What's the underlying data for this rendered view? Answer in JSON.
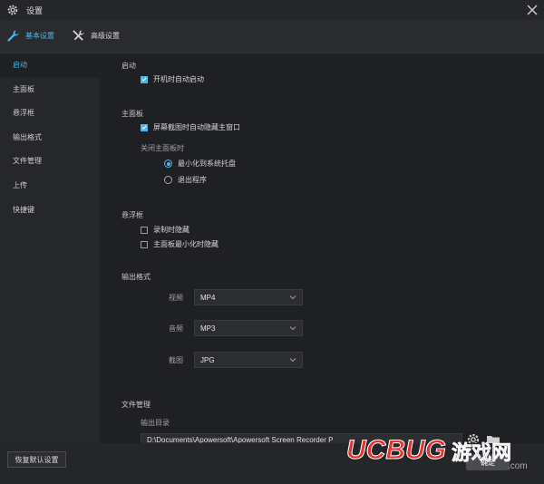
{
  "window": {
    "title": "设置"
  },
  "tabs": [
    {
      "label": "基本设置"
    },
    {
      "label": "高级设置"
    }
  ],
  "sidebar": {
    "items": [
      {
        "label": "启动"
      },
      {
        "label": "主面板"
      },
      {
        "label": "悬浮框"
      },
      {
        "label": "输出格式"
      },
      {
        "label": "文件管理"
      },
      {
        "label": "上传"
      },
      {
        "label": "快捷键"
      }
    ]
  },
  "startup": {
    "title": "启动",
    "auto_start": "开机时自动启动"
  },
  "main_panel": {
    "title": "主面板",
    "hide_on_capture": "屏幕截图时自动隐藏主窗口",
    "close_label": "关闭主面板时",
    "minimize_to_tray": "最小化到系统托盘",
    "exit_program": "退出程序"
  },
  "float_box": {
    "title": "悬浮框",
    "hide_on_record": "录制时隐藏",
    "hide_on_minimize": "主面板最小化时隐藏"
  },
  "output_format": {
    "title": "输出格式",
    "video_label": "视频",
    "video_value": "MP4",
    "audio_label": "音频",
    "audio_value": "MP3",
    "screenshot_label": "截图",
    "screenshot_value": "JPG"
  },
  "file_management": {
    "title": "文件管理",
    "output_dir_label": "输出目录",
    "output_dir_value": "D:\\Documents\\Apowersoft\\Apowersoft Screen Recorder P"
  },
  "footer": {
    "reset_label": "恢复默认设置",
    "ok_label": "确定"
  },
  "watermark": {
    "brand": "UCBUG",
    "cn": "游戏网",
    "domain": ".com"
  },
  "colors": {
    "accent": "#4cb6ea",
    "bg": "#1f2023",
    "sidebar": "#26272b"
  }
}
